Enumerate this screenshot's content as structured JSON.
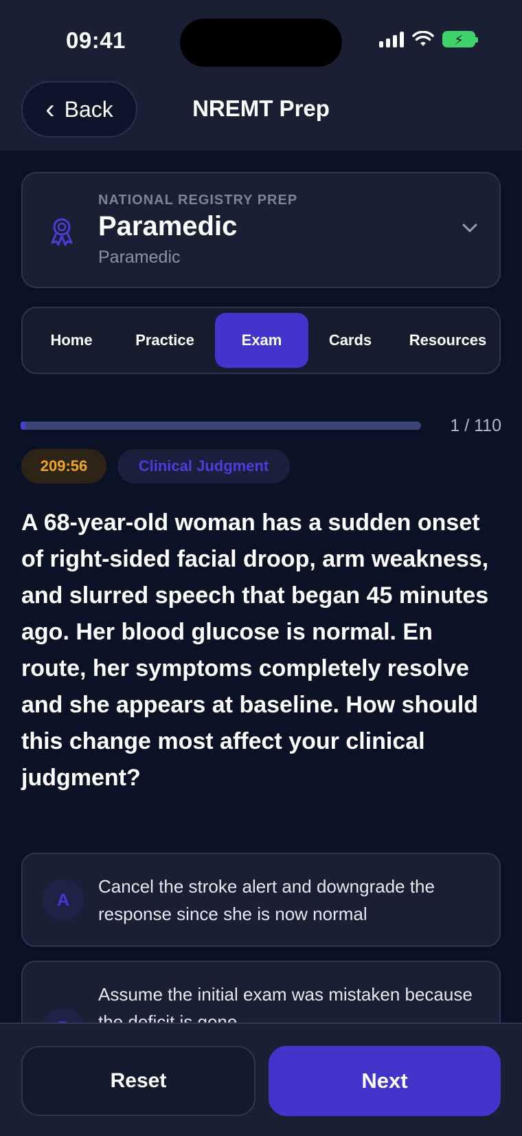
{
  "status_bar": {
    "time": "09:41"
  },
  "nav": {
    "back_label": "Back",
    "title": "NREMT Prep"
  },
  "course": {
    "eyebrow": "NATIONAL REGISTRY PREP",
    "title": "Paramedic",
    "subtitle": "Paramedic",
    "icon": "award-ribbon-icon"
  },
  "tabs": [
    {
      "label": "Home",
      "active": false
    },
    {
      "label": "Practice",
      "active": false
    },
    {
      "label": "Exam",
      "active": true
    },
    {
      "label": "Cards",
      "active": false
    },
    {
      "label": "Resources",
      "active": false
    }
  ],
  "exam": {
    "progress_text": "1 / 110",
    "progress_fraction": 0.009,
    "timer": "209:56",
    "category": "Clinical Judgment",
    "question": "A 68-year-old woman has a sudden onset of right-sided facial droop, arm weakness, and slurred speech that began 45 minutes ago. Her blood glucose is normal. En route, her symptoms completely resolve and she appears at baseline. How should this change most affect your clinical judgment?",
    "options": [
      {
        "letter": "A",
        "text": "Cancel the stroke alert and downgrade the response since she is now normal"
      },
      {
        "letter": "B",
        "text": "Assume the initial exam was mistaken because the deficit is gone"
      }
    ]
  },
  "actions": {
    "reset_label": "Reset",
    "next_label": "Next"
  },
  "colors": {
    "background": "#0b1226",
    "surface": "#1a1f33",
    "accent": "#4335cc",
    "timer": "#f0a52a",
    "battery": "#3fd36b"
  }
}
